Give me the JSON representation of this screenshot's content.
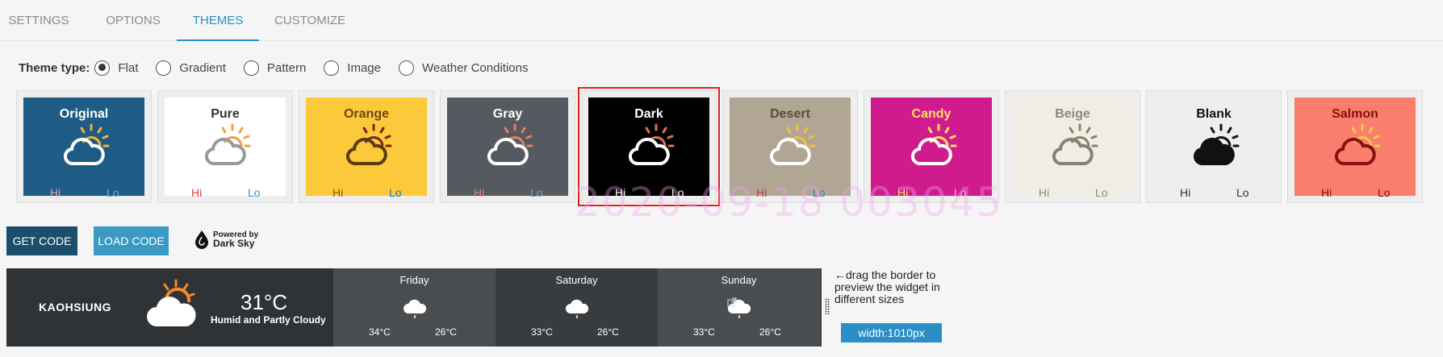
{
  "tabs": [
    {
      "label": "SETTINGS"
    },
    {
      "label": "OPTIONS"
    },
    {
      "label": "THEMES",
      "active": true
    },
    {
      "label": "CUSTOMIZE"
    }
  ],
  "theme_type": {
    "label": "Theme type:",
    "options": [
      "Flat",
      "Gradient",
      "Pattern",
      "Image",
      "Weather Conditions"
    ],
    "selected": "Flat"
  },
  "themes": [
    {
      "name": "Original",
      "bg": "#1e5c86",
      "title_color": "#ffffff",
      "hi_color": "#f2a0b0",
      "lo_color": "#6ab0e0",
      "cloud": "#ffffff",
      "cloud_fill": "none",
      "sun": "#f2b233",
      "hi": "Hi",
      "lo": "Lo"
    },
    {
      "name": "Pure",
      "bg": "#ffffff",
      "title_color": "#333333",
      "hi_color": "#e04040",
      "lo_color": "#3a90d0",
      "cloud": "#999999",
      "cloud_fill": "none",
      "sun": "#f0a040",
      "hi": "Hi",
      "lo": "Lo"
    },
    {
      "name": "Orange",
      "bg": "#fbc939",
      "title_color": "#6a4a10",
      "hi_color": "#8a5a10",
      "lo_color": "#2a70b0",
      "cloud": "#5a3a10",
      "cloud_fill": "none",
      "sun": "#7a2020",
      "hi": "Hi",
      "lo": "Lo"
    },
    {
      "name": "Gray",
      "bg": "#545a60",
      "title_color": "#ffffff",
      "hi_color": "#e08080",
      "lo_color": "#60a8e0",
      "cloud": "#ffffff",
      "cloud_fill": "#545a60",
      "sun": "#e08060",
      "hi": "Hi",
      "lo": "Lo"
    },
    {
      "name": "Dark",
      "bg": "#000000",
      "title_color": "#ffffff",
      "hi_color": "#ffffff",
      "lo_color": "#ffffff",
      "cloud": "#ffffff",
      "cloud_fill": "#000000",
      "sun": "#e07050",
      "hi": "Hi",
      "lo": "Lo",
      "selected": true
    },
    {
      "name": "Desert",
      "bg": "#b1a594",
      "title_color": "#5a4a3a",
      "hi_color": "#c04050",
      "lo_color": "#3a80c0",
      "cloud": "#ffffff",
      "cloud_fill": "none",
      "sun": "#f0c040",
      "hi": "Hi",
      "lo": "Lo"
    },
    {
      "name": "Candy",
      "bg": "#d01b8f",
      "title_color": "#ffe060",
      "hi_color": "#ffe060",
      "lo_color": "#ffb0d8",
      "cloud": "#ffffff",
      "cloud_fill": "none",
      "sun": "#ffe060",
      "hi": "Hi",
      "lo": "Lo"
    },
    {
      "name": "Beige",
      "bg": "#f0ede4",
      "title_color": "#8a8a80",
      "hi_color": "#8a8a80",
      "lo_color": "#8a8a80",
      "cloud": "#8a8070",
      "cloud_fill": "none",
      "sun": "#8a8070",
      "hi": "Hi",
      "lo": "Lo"
    },
    {
      "name": "Blank",
      "bg": "#eeeeee",
      "title_color": "#111111",
      "hi_color": "#333333",
      "lo_color": "#333333",
      "cloud": "#111111",
      "cloud_fill": "#111111",
      "sun": "#111111",
      "hi": "Hi",
      "lo": "Lo"
    },
    {
      "name": "Salmon",
      "bg": "#f97e6e",
      "title_color": "#8a1010",
      "hi_color": "#8a1010",
      "lo_color": "#8a1010",
      "cloud": "#8a1010",
      "cloud_fill": "none",
      "sun": "#f0d040",
      "hi": "Hi",
      "lo": "Lo"
    }
  ],
  "watermark": "2020-09-18  003045",
  "buttons": {
    "get_code": "GET CODE",
    "load_code": "LOAD CODE"
  },
  "powered": {
    "line1": "Powered by",
    "line2": "Dark Sky"
  },
  "widget": {
    "city": "KAOHSIUNG",
    "temp": "31°C",
    "condition": "Humid and Partly Cloudy",
    "days": [
      {
        "name": "Friday",
        "high": "34°C",
        "low": "26°C"
      },
      {
        "name": "Saturday",
        "high": "33°C",
        "low": "26°C"
      },
      {
        "name": "Sunday",
        "high": "33°C",
        "low": "26°C"
      }
    ]
  },
  "hint": "drag the border to preview the widget in different sizes",
  "hint_arrow": "←",
  "width_label": "width:1010px"
}
